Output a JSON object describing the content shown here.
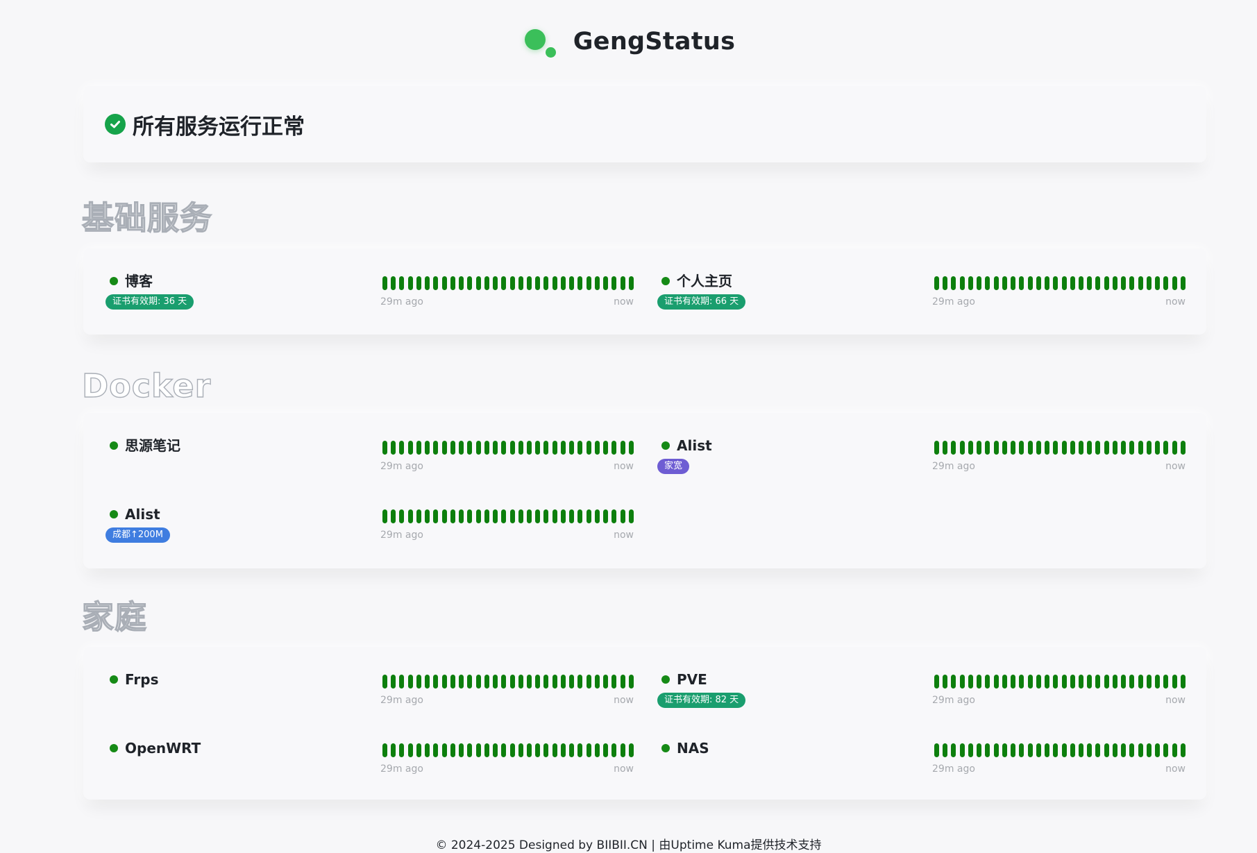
{
  "header": {
    "title": "GengStatus",
    "logo_color": "#3bbf5a"
  },
  "overall": {
    "icon": "check-circle-icon",
    "text": "所有服务运行正常",
    "color": "#16a34a"
  },
  "groups": [
    {
      "title": "基础服务",
      "monitors": [
        {
          "name": "博客",
          "tag": "证书有效期: 36 天",
          "tag_color": "#1a9e6e",
          "status": "up",
          "time_left": "29m ago",
          "time_right": "now"
        },
        {
          "name": "个人主页",
          "tag": "证书有效期: 66 天",
          "tag_color": "#1a9e6e",
          "status": "up",
          "time_left": "29m ago",
          "time_right": "now"
        }
      ]
    },
    {
      "title": "Docker",
      "monitors": [
        {
          "name": "思源笔记",
          "tag": "",
          "status": "up",
          "time_left": "29m ago",
          "time_right": "now"
        },
        {
          "name": "Alist",
          "tag": "家宽",
          "tag_color": "#6e5dd3",
          "status": "up",
          "time_left": "29m ago",
          "time_right": "now"
        },
        {
          "name": "Alist",
          "tag": "成都↑200M",
          "tag_color": "#3f7de0",
          "status": "up",
          "time_left": "29m ago",
          "time_right": "now"
        }
      ]
    },
    {
      "title": "家庭",
      "monitors": [
        {
          "name": "Frps",
          "tag": "",
          "status": "up",
          "time_left": "29m ago",
          "time_right": "now"
        },
        {
          "name": "PVE",
          "tag": "证书有效期: 82 天",
          "tag_color": "#1a9e6e",
          "status": "up",
          "time_left": "29m ago",
          "time_right": "now"
        },
        {
          "name": "OpenWRT",
          "tag": "",
          "status": "up",
          "time_left": "29m ago",
          "time_right": "now"
        },
        {
          "name": "NAS",
          "tag": "",
          "status": "up",
          "time_left": "29m ago",
          "time_right": "now"
        }
      ]
    }
  ],
  "heartbeat_count": 30,
  "heartbeat_color": "#0d7f0d",
  "footer": {
    "text": "© 2024-2025 Designed by BIIBII.CN | 由Uptime Kuma提供技术支持"
  }
}
